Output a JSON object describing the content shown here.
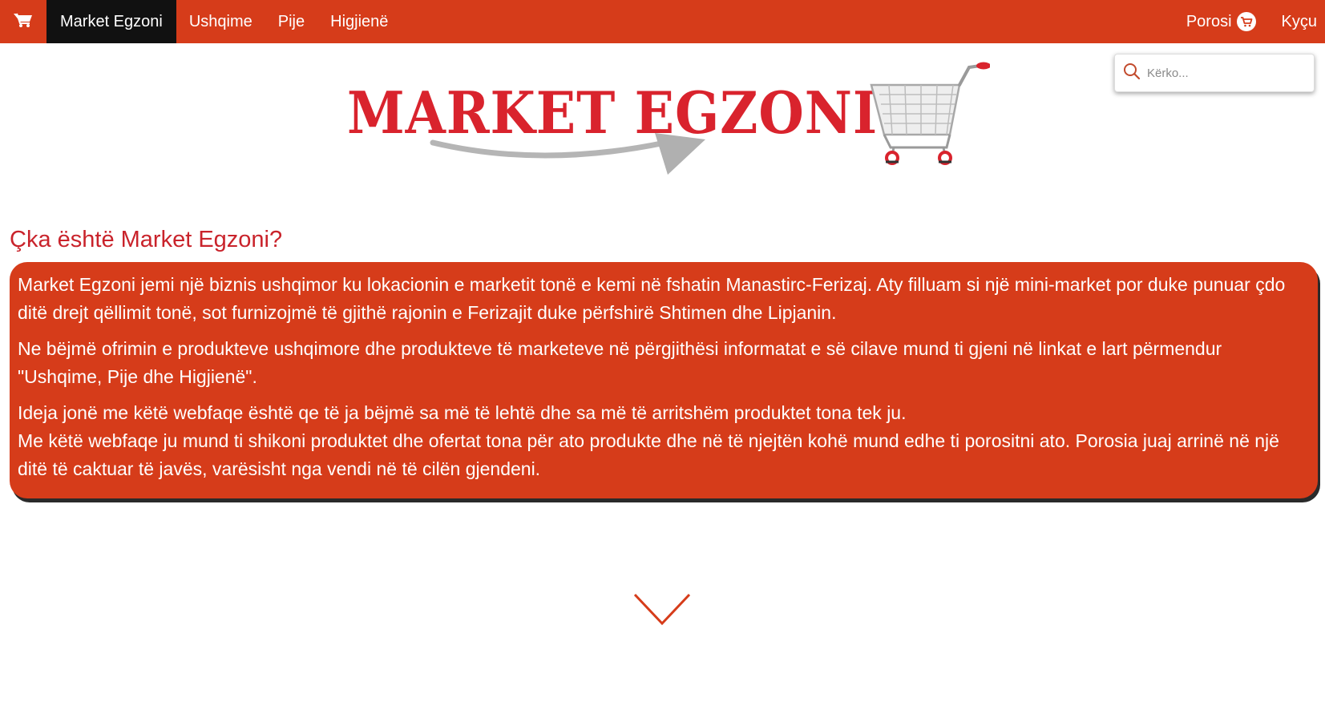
{
  "nav": {
    "home_icon": "cart-icon",
    "brand": "Market Egzoni",
    "items": [
      {
        "label": "Ushqime"
      },
      {
        "label": "Pije"
      },
      {
        "label": "Higjienë"
      }
    ],
    "orders_label": "Porosi",
    "orders_icon": "cart-badge-icon",
    "login_label": "Kyçu"
  },
  "search": {
    "placeholder": "Kërko...",
    "value": ""
  },
  "logo": {
    "text": "MARKET EGZONI"
  },
  "about": {
    "title": "Çka është Market Egzoni?",
    "paragraphs": [
      "Market Egzoni jemi një biznis ushqimor ku lokacionin e marketit tonë e kemi në fshatin Manastirc-Ferizaj. Aty filluam si një mini-market por duke punuar çdo ditë drejt qëllimit tonë, sot furnizojmë të gjithë rajonin e Ferizajit duke përfshirë Shtimen dhe Lipjanin.",
      "Ne bëjmë ofrimin e produkteve ushqimore dhe produkteve të marketeve në përgjithësi informatat e së cilave mund ti gjeni në linkat e lart përmendur \"Ushqime, Pije dhe Higjienë\".",
      "Ideja jonë me këtë webfaqe është qe të ja bëjmë sa më të lehtë dhe sa më të arritshëm produktet tona tek ju.",
      "Me këtë webfaqe ju mund ti shikoni produktet dhe ofertat tona për ato produkte dhe në të njejtën kohë mund edhe ti porositni ato. Porosia juaj arrinë në një ditë të caktuar të javës, varësisht nga vendi në të cilën gjendeni."
    ]
  },
  "colors": {
    "brand_red": "#d63c1a",
    "logo_red": "#d9232d",
    "active_nav": "#111111"
  },
  "scroll_icon": "chevron-down-icon"
}
